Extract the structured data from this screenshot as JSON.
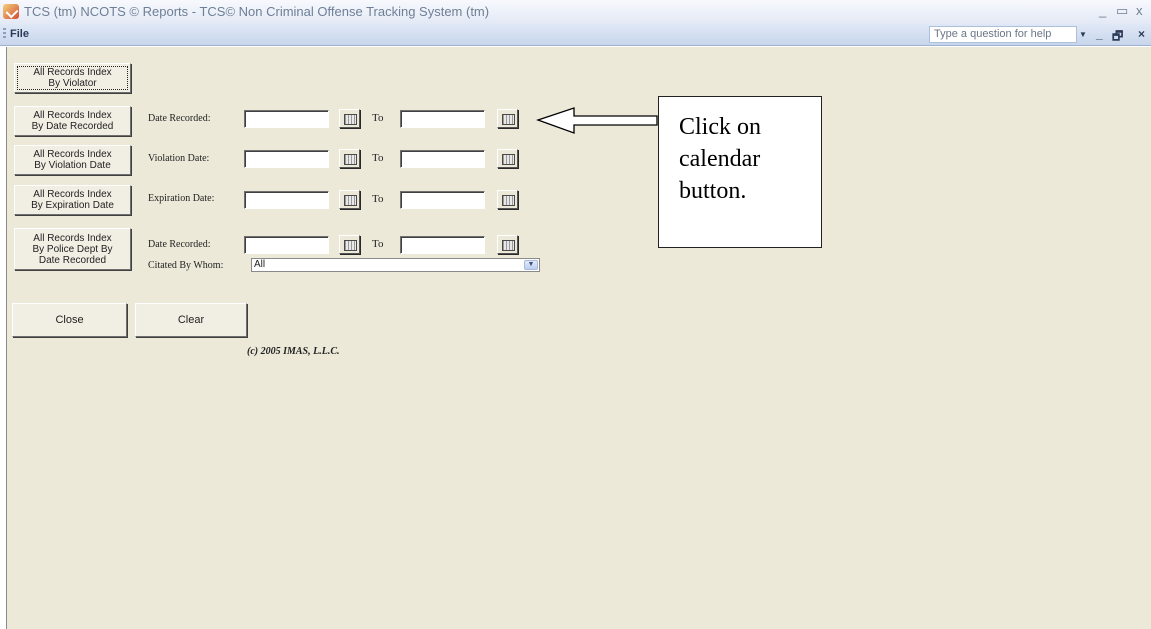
{
  "window": {
    "title": "TCS (tm) NCOTS © Reports - TCS© Non Criminal Offense Tracking System (tm)",
    "minimize": "_",
    "restore": "▭",
    "close": "x"
  },
  "menu": {
    "file": "File",
    "help_placeholder": "Type a question for help",
    "help_dropdown": "▼",
    "mdi_minimize": "_",
    "mdi_restore": "🗗",
    "mdi_close": "×"
  },
  "report_buttons": {
    "by_violator": "All Records Index\nBy Violator",
    "by_date_recorded": "All Records Index\nBy Date Recorded",
    "by_violation_date": "All Records Index\nBy Violation Date",
    "by_expiration_date": "All Records Index\nBy Expiration Date",
    "by_police_dept": "All Records Index\nBy Police Dept By\nDate Recorded"
  },
  "filters": {
    "date_recorded_label": "Date Recorded:",
    "violation_date_label": "Violation Date:",
    "expiration_date_label": "Expiration Date:",
    "date_recorded_2_label": "Date Recorded:",
    "to_label": "To",
    "citated_by_label": "Citated By Whom:",
    "citated_by_value": "All",
    "select_arrow": "▼"
  },
  "actions": {
    "close": "Close",
    "clear": "Clear"
  },
  "footer": {
    "copyright": "(c) 2005 IMAS, L.L.C."
  },
  "annotation": {
    "callout": "Click on\ncalendar\nbutton."
  }
}
